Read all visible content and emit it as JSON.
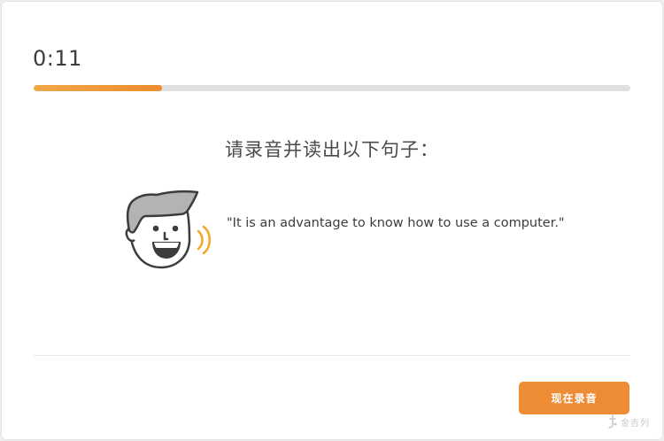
{
  "timer": {
    "text": "0:11"
  },
  "progress": {
    "fraction": 0.215,
    "fill_color": "#f0a848",
    "fill_color_end": "#ec8c2e"
  },
  "prompt": {
    "text": "请录音并读出以下句子："
  },
  "speaker": {
    "icon": "speaking-man-icon",
    "face_color": "#3c3c3c",
    "hair_color": "#b3b3b3",
    "wave_color": "#f5a623"
  },
  "sentence": {
    "text": "\"It is an advantage to know how to use a computer.\""
  },
  "record_button": {
    "label": "现在录音",
    "color": "#ee8c35"
  },
  "watermark": {
    "text": "金吉列",
    "icon": "logo-icon"
  }
}
